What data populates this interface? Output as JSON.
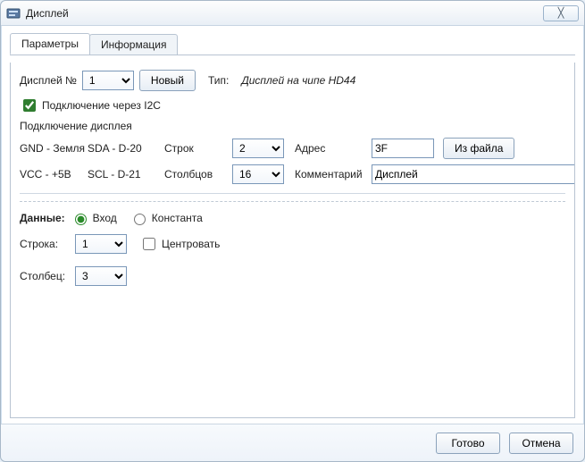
{
  "window": {
    "title": "Дисплей",
    "close_glyph": "╳"
  },
  "tabs": {
    "params": "Параметры",
    "info": "Информация"
  },
  "top": {
    "display_no_label": "Дисплей №",
    "display_no_value": "1",
    "new_button": "Новый",
    "type_label": "Тип:",
    "type_value": "Дисплей на чипе HD44"
  },
  "i2c": {
    "checkbox_label": "Подключение через I2C"
  },
  "conn": {
    "section": "Подключение дисплея",
    "gnd_label": "GND - Земля",
    "sda_label": "SDA - D-20",
    "rows_label": "Строк",
    "rows_value": "2",
    "addr_label": "Адрес",
    "addr_value": "3F",
    "file_button": "Из файла",
    "vcc_label": "VCC - +5В",
    "scl_label": "SCL - D-21",
    "cols_label": "Столбцов",
    "cols_value": "16",
    "comment_label": "Комментарий",
    "comment_value": "Дисплей"
  },
  "data": {
    "label": "Данные:",
    "opt_input": "Вход",
    "opt_const": "Константа"
  },
  "pos": {
    "row_label": "Строка:",
    "row_value": "1",
    "center_label": "Центровать",
    "col_label": "Столбец:",
    "col_value": "3"
  },
  "footer": {
    "ok": "Готово",
    "cancel": "Отмена"
  }
}
